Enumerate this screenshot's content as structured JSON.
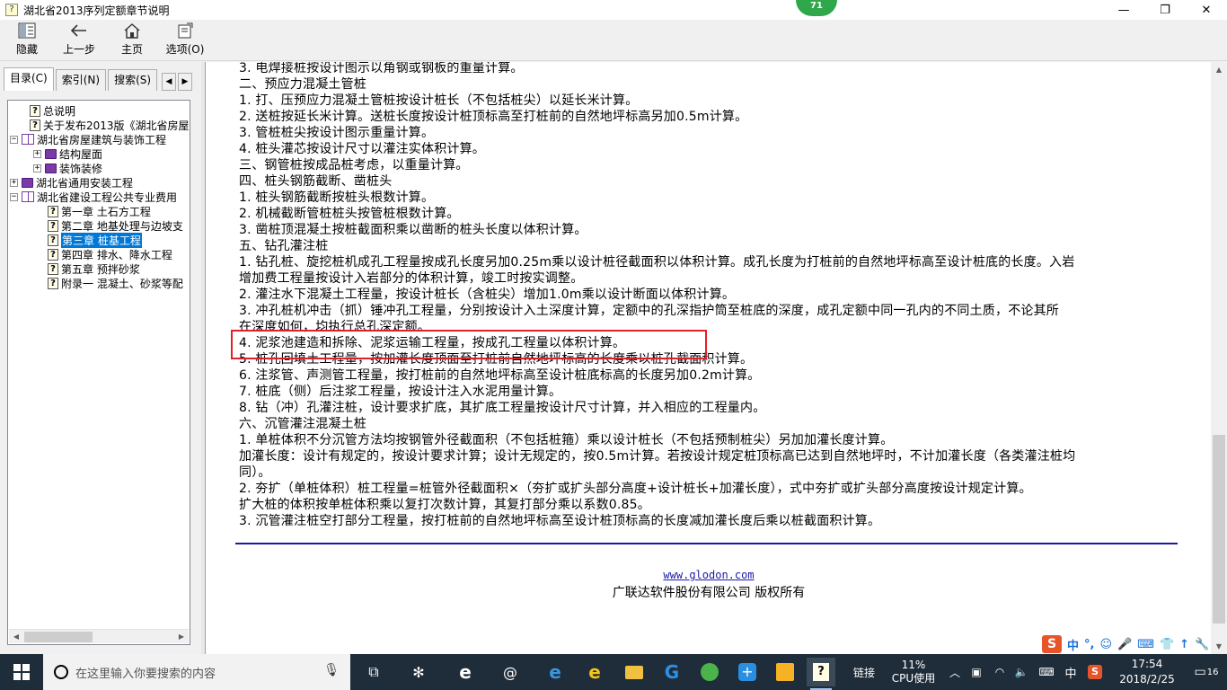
{
  "window": {
    "title": "湖北省2013序列定额章节说明",
    "badge": "71",
    "minimize": "—",
    "maximize": "❐",
    "close": "✕"
  },
  "toolbar": {
    "hide": "隐藏",
    "back": "上一步",
    "home": "主页",
    "options": "选项(O)"
  },
  "tabs": [
    "目录(C)",
    "索引(N)",
    "搜索(S)"
  ],
  "tree": [
    {
      "label": "总说明",
      "icon": "help-page-icon",
      "level": 1,
      "expander": ""
    },
    {
      "label": "关于发布2013版《湖北省房屋",
      "icon": "help-page-icon",
      "level": 1,
      "expander": ""
    },
    {
      "label": "湖北省房屋建筑与装饰工程",
      "icon": "open-book-icon",
      "level": 0,
      "expander": "−"
    },
    {
      "label": "结构屋面",
      "icon": "book-icon",
      "level": 1,
      "expander": "+"
    },
    {
      "label": "装饰装修",
      "icon": "book-icon",
      "level": 1,
      "expander": "+"
    },
    {
      "label": "湖北省通用安装工程",
      "icon": "book-icon",
      "level": 0,
      "expander": "+"
    },
    {
      "label": "湖北省建设工程公共专业费用",
      "icon": "open-book-icon",
      "level": 0,
      "expander": "−"
    },
    {
      "label": "第一章  土石方工程",
      "icon": "help-page-icon",
      "level": 2,
      "expander": ""
    },
    {
      "label": "第二章  地基处理与边坡支",
      "icon": "help-page-icon",
      "level": 2,
      "expander": ""
    },
    {
      "label": "第三章  桩基工程",
      "icon": "help-page-icon",
      "level": 2,
      "expander": "",
      "selected": true
    },
    {
      "label": "第四章  排水、降水工程",
      "icon": "help-page-icon",
      "level": 2,
      "expander": ""
    },
    {
      "label": "第五章  预拌砂浆",
      "icon": "help-page-icon",
      "level": 2,
      "expander": ""
    },
    {
      "label": "附录一  混凝土、砂浆等配",
      "icon": "help-page-icon",
      "level": 2,
      "expander": ""
    }
  ],
  "content_lines": [
    "3. 电焊接桩按设计图示以角钢或钢板的重量计算。",
    "二、预应力混凝土管桩",
    "1. 打、压预应力混凝土管桩按设计桩长（不包括桩尖）以延长米计算。",
    "2. 送桩按延长米计算。送桩长度按设计桩顶标高至打桩前的自然地坪标高另加0.5m计算。",
    "3. 管桩桩尖按设计图示重量计算。",
    "4. 桩头灌芯按设计尺寸以灌注实体积计算。",
    "三、钢管桩按成品桩考虑，以重量计算。",
    "四、桩头钢筋截断、凿桩头",
    "1. 桩头钢筋截断按桩头根数计算。",
    "2. 机械截断管桩桩头按管桩根数计算。",
    "3. 凿桩顶混凝土按桩截面积乘以凿断的桩头长度以体积计算。",
    "五、钻孔灌注桩",
    "1. 钻孔桩、旋挖桩机成孔工程量按成孔长度另加0.25m乘以设计桩径截面积以体积计算。成孔长度为打桩前的自然地坪标高至设计桩底的长度。入岩",
    "增加费工程量按设计入岩部分的体积计算，竣工时按实调整。",
    "2. 灌注水下混凝土工程量，按设计桩长（含桩尖）增加1.0m乘以设计断面以体积计算。",
    "3. 冲孔桩机冲击（抓）锤冲孔工程量，分别按设计入土深度计算，定额中的孔深指护筒至桩底的深度，成孔定额中同一孔内的不同土质，不论其所",
    "在深度如何，均执行总孔深定额。",
    "4. 泥浆池建造和拆除、泥浆运输工程量，按成孔工程量以体积计算。",
    "5. 桩孔回填土工程量，按加灌长度顶面至打桩前自然地坪标高的长度乘以桩孔截面积计算。",
    "6. 注浆管、声测管工程量，按打桩前的自然地坪标高至设计桩底标高的长度另加0.2m计算。",
    "7. 桩底（侧）后注浆工程量，按设计注入水泥用量计算。",
    "8. 钻（冲）孔灌注桩，设计要求扩底，其扩底工程量按设计尺寸计算，并入相应的工程量内。",
    "六、沉管灌注混凝土桩",
    "1. 单桩体积不分沉管方法均按钢管外径截面积（不包括桩箍）乘以设计桩长（不包括预制桩尖）另加加灌长度计算。",
    "加灌长度：设计有规定的，按设计要求计算；设计无规定的，按0.5m计算。若按设计规定桩顶标高已达到自然地坪时，不计加灌长度（各类灌注桩均",
    "同）。",
    "2. 夯扩（单桩体积）桩工程量=桩管外径截面积×（夯扩或扩头部分高度+设计桩长+加灌长度），式中夯扩或扩头部分高度按设计规定计算。",
    "扩大桩的体积按单桩体积乘以复打次数计算，其复打部分乘以系数0.85。",
    "3. 沉管灌注桩空打部分工程量，按打桩前的自然地坪标高至设计桩顶标高的长度减加灌长度后乘以桩截面积计算。"
  ],
  "footer": {
    "url": "www.glodon.com",
    "copyright": "广联达软件股份有限公司 版权所有"
  },
  "ime": [
    "中",
    "°,",
    "☺",
    "🎤",
    "⌨",
    "👕",
    "↑",
    "🔧"
  ],
  "taskbar": {
    "search_placeholder": "在这里输入你要搜索的内容",
    "link_label": "链接",
    "cpu_percent": "11%",
    "cpu_label": "CPU使用",
    "input_lang": "中",
    "time": "17:54",
    "date": "2018/2/25",
    "notifications": "16"
  }
}
